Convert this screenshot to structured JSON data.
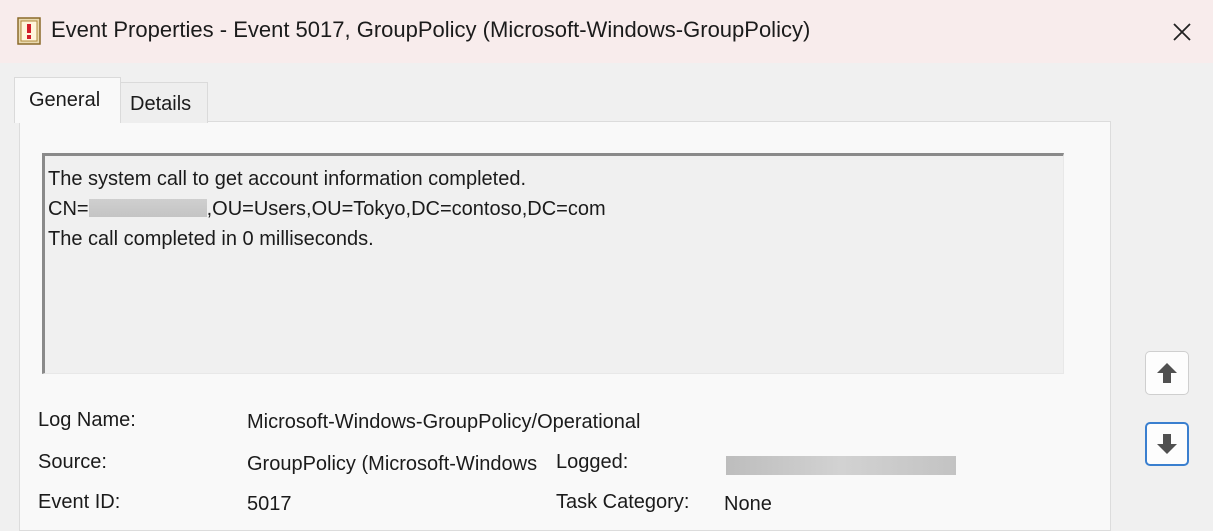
{
  "window": {
    "title": "Event Properties - Event 5017, GroupPolicy (Microsoft-Windows-GroupPolicy)",
    "app_icon": "event-viewer-icon",
    "close_icon": "close-icon"
  },
  "tabs": [
    {
      "label": "General",
      "selected": true
    },
    {
      "label": "Details",
      "selected": false
    }
  ],
  "message": {
    "line1": "The system call to get account information completed.",
    "line2_prefix": "CN=",
    "line2_suffix": ",OU=Users,OU=Tokyo,DC=contoso,DC=com",
    "line3": "The call completed in 0 milliseconds."
  },
  "fields": {
    "log_name": {
      "label": "Log Name:",
      "value": "Microsoft-Windows-GroupPolicy/Operational"
    },
    "source": {
      "label": "Source:",
      "value": "GroupPolicy (Microsoft-Windows-GroupPolicy)"
    },
    "logged": {
      "label": "Logged:"
    },
    "event_id": {
      "label": "Event ID:",
      "value": "5017"
    },
    "task_category": {
      "label": "Task Category:",
      "value": "None"
    }
  },
  "nav": {
    "up_icon": "arrow-up-icon",
    "down_icon": "arrow-down-icon"
  },
  "colors": {
    "titlebar": "#f8ecec",
    "focus_border": "#3a7fcf"
  }
}
